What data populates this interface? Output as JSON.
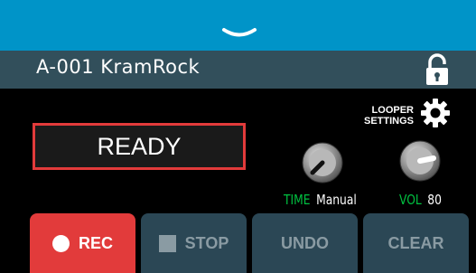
{
  "topbar": {
    "color": "#0094c8",
    "icon": "chevron-down-icon"
  },
  "header": {
    "patch_name": "A-001 KramRock",
    "lock_icon": "lock-icon"
  },
  "status": {
    "text": "READY",
    "border_color": "#e23b3b"
  },
  "looper_settings": {
    "line1": "LOOPER",
    "line2": "SETTINGS",
    "icon": "gear-icon"
  },
  "params": {
    "time": {
      "label": "TIME",
      "value": "Manual"
    },
    "vol": {
      "label": "VOL",
      "value": "80"
    }
  },
  "buttons": {
    "rec": {
      "label": "REC",
      "color": "#e23b3b"
    },
    "stop": {
      "label": "STOP"
    },
    "undo": {
      "label": "UNDO"
    },
    "clear": {
      "label": "CLEAR"
    }
  },
  "colors": {
    "accent_blue": "#0094c8",
    "param_green": "#00c040",
    "button_inactive": "#2b4755"
  }
}
